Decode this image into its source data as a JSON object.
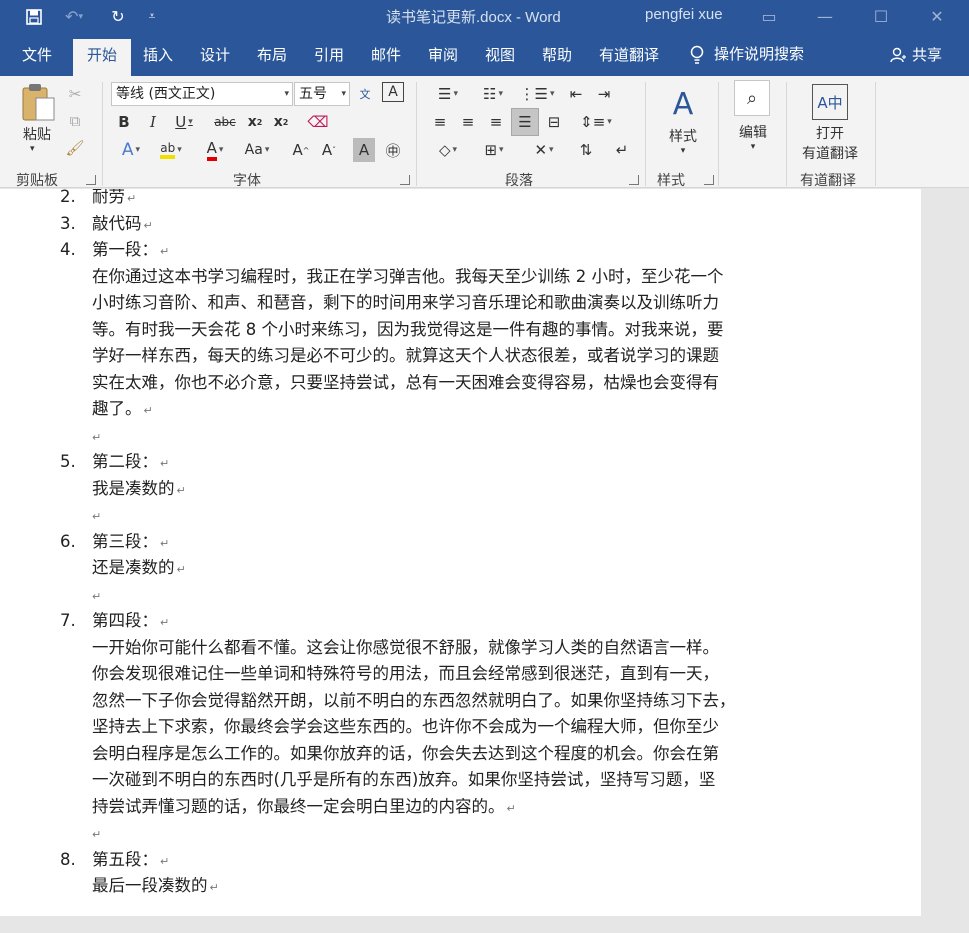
{
  "window": {
    "doc_title": "读书笔记更新.docx - Word",
    "user": "pengfei xue"
  },
  "tabs": [
    "文件",
    "开始",
    "插入",
    "设计",
    "布局",
    "引用",
    "邮件",
    "审阅",
    "视图",
    "帮助",
    "有道翻译"
  ],
  "tell_me": "操作说明搜索",
  "share": "共享",
  "ribbon": {
    "clipboard": {
      "paste": "粘贴",
      "label": "剪贴板"
    },
    "font": {
      "font_name": "等线 (西文正文)",
      "font_size": "五号",
      "label": "字体"
    },
    "paragraph": {
      "label": "段落"
    },
    "styles": {
      "button": "样式",
      "label": "样式"
    },
    "editing": {
      "button": "编辑"
    },
    "youdao": {
      "button_line1": "打开",
      "button_line2": "有道翻译",
      "label": "有道翻译"
    }
  },
  "document": {
    "items": [
      {
        "num": "2.",
        "title": "耐劳"
      },
      {
        "num": "3.",
        "title": "敲代码"
      },
      {
        "num": "4.",
        "title": "第一段：",
        "body": [
          "在你通过这本书学习编程时，我正在学习弹吉他。我每天至少训练 2 小时，至少花一个",
          "小时练习音阶、和声、和琶音，剩下的时间用来学习音乐理论和歌曲演奏以及训练听力",
          "等。有时我一天会花 8 个小时来练习，因为我觉得这是一件有趣的事情。对我来说，要",
          "学好一样东西，每天的练习是必不可少的。就算这天个人状态很差，或者说学习的课题",
          "实在太难，你也不必介意，只要坚持尝试，总有一天困难会变得容易，枯燥也会变得有",
          "趣了。"
        ]
      },
      {
        "num": "5.",
        "title": "第二段：",
        "body": [
          "我是凑数的"
        ]
      },
      {
        "num": "6.",
        "title": "第三段：",
        "body": [
          "还是凑数的"
        ]
      },
      {
        "num": "7.",
        "title": "第四段：",
        "body": [
          "一开始你可能什么都看不懂。这会让你感觉很不舒服，就像学习人类的自然语言一样。",
          "你会发现很难记住一些单词和特殊符号的用法，而且会经常感到很迷茫，直到有一天，",
          "忽然一下子你会觉得豁然开朗，以前不明白的东西忽然就明白了。如果你坚持练习下去，",
          "坚持去上下求索，你最终会学会这些东西的。也许你不会成为一个编程大师，但你至少",
          "会明白程序是怎么工作的。如果你放弃的话，你会失去达到这个程度的机会。你会在第",
          "一次碰到不明白的东西时(几乎是所有的东西)放弃。如果你坚持尝试，坚持写习题，坚",
          "持尝试弄懂习题的话，你最终一定会明白里边的内容的。"
        ]
      },
      {
        "num": "8.",
        "title": "第五段：",
        "body": [
          "最后一段凑数的"
        ]
      }
    ],
    "paragraph_mark": "↵"
  }
}
